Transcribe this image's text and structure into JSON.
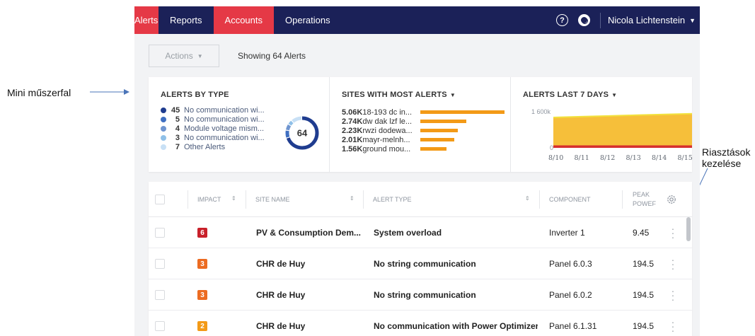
{
  "annotations": {
    "left": "Mini műszerfal",
    "right_line1": "Riasztások",
    "right_line2": "kezelése"
  },
  "nav": {
    "tabs": [
      {
        "label": "Alerts"
      },
      {
        "label": "Reports"
      },
      {
        "label": "Accounts"
      },
      {
        "label": "Operations"
      }
    ],
    "user": "Nicola Lichtenstein",
    "help_icon": "question-circle-icon",
    "support_icon": "lifebuoy-icon",
    "accent": "#e53946",
    "bar_color": "#1b2158"
  },
  "toolbar": {
    "actions_label": "Actions",
    "showing": "Showing 64 Alerts"
  },
  "alerts_by_type": {
    "title": "ALERTS BY TYPE",
    "total": "64",
    "items": [
      {
        "count": "45",
        "label": "No communication wi...",
        "color": "#1f3c8f"
      },
      {
        "count": "5",
        "label": "No communication wi...",
        "color": "#3f6fc1"
      },
      {
        "count": "4",
        "label": "Module voltage mism...",
        "color": "#6f95d0"
      },
      {
        "count": "3",
        "label": "No communication wi...",
        "color": "#8fc0e8"
      },
      {
        "count": "7",
        "label": "Other Alerts",
        "color": "#c8e0f5"
      }
    ]
  },
  "sites_most_alerts": {
    "title": "SITES WITH MOST ALERTS",
    "items": [
      {
        "value": "5.06K",
        "name": "18-193 dc in...",
        "fraction": 1.0
      },
      {
        "value": "2.74K",
        "name": "dw dak lzf le...",
        "fraction": 0.54
      },
      {
        "value": "2.23K",
        "name": "rwzi dodewa...",
        "fraction": 0.44
      },
      {
        "value": "2.01K",
        "name": "mayr-melnh...",
        "fraction": 0.4
      },
      {
        "value": "1.56K",
        "name": "ground mou...",
        "fraction": 0.31
      }
    ]
  },
  "alerts_7days": {
    "title": "ALERTS LAST 7 DAYS",
    "y_top_label": "1 600k",
    "y_bottom_label": "0",
    "x_labels": [
      "8/10",
      "8/11",
      "8/12",
      "8/13",
      "8/14",
      "8/15"
    ]
  },
  "chart_data": {
    "type": "area",
    "title": "ALERTS LAST 7 DAYS",
    "x": [
      "8/10",
      "8/11",
      "8/12",
      "8/13",
      "8/14",
      "8/15"
    ],
    "series": [
      {
        "values": [
          1230000,
          1260000,
          1290000,
          1320000,
          1350000,
          1380000
        ],
        "color": "#f6bf3a"
      },
      {
        "values": [
          100000,
          100000,
          100000,
          100000,
          100000,
          100000
        ],
        "color": "#d62f2f"
      }
    ],
    "ylim": [
      0,
      1600000
    ]
  },
  "table": {
    "headers": {
      "impact": "IMPACT",
      "site": "SITE NAME",
      "alert_type": "ALERT TYPE",
      "component": "COMPONENT",
      "peak1": "PEAK",
      "peak2": "POWEF"
    },
    "rows": [
      {
        "impact": "6",
        "impact_color": "#c8202a",
        "site": "PV & Consumption Dem...",
        "alert": "System overload",
        "component": "Inverter 1",
        "peak": "9.45"
      },
      {
        "impact": "3",
        "impact_color": "#ec6b21",
        "site": "CHR de Huy",
        "alert": "No string communication",
        "component": "Panel 6.0.3",
        "peak": "194.5"
      },
      {
        "impact": "3",
        "impact_color": "#ec6b21",
        "site": "CHR de Huy",
        "alert": "No string communication",
        "component": "Panel 6.0.2",
        "peak": "194.5"
      },
      {
        "impact": "2",
        "impact_color": "#f39a17",
        "site": "CHR de Huy",
        "alert": "No communication with Power Optimizer",
        "component": "Panel 6.1.31",
        "peak": "194.5"
      }
    ]
  }
}
